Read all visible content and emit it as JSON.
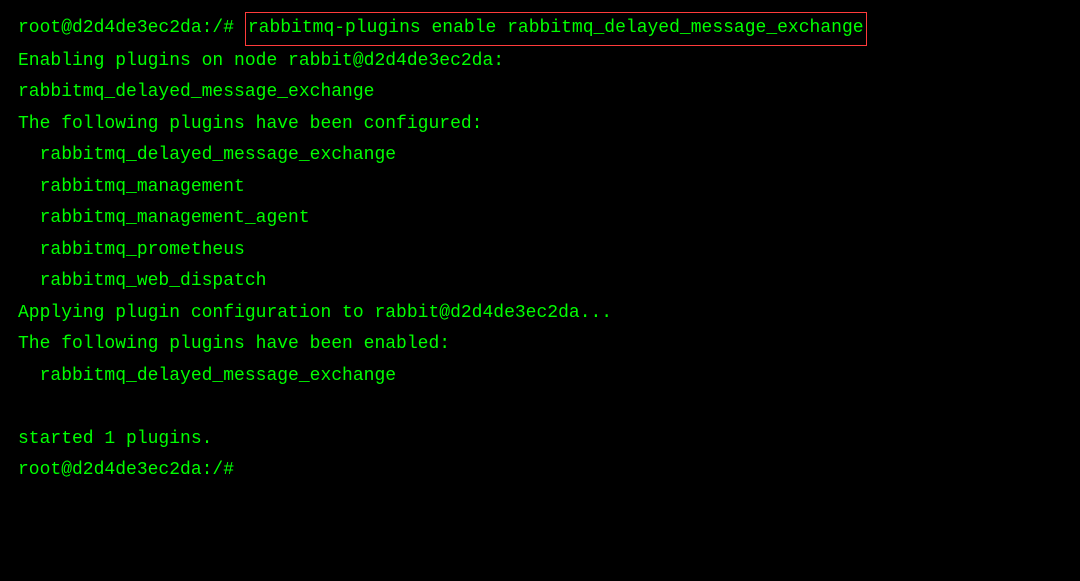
{
  "terminal": {
    "prompt1_prefix": "root@d2d4de3ec2da:/# ",
    "command": "rabbitmq-plugins enable rabbitmq_delayed_message_exchange",
    "line2": "Enabling plugins on node rabbit@d2d4de3ec2da:",
    "line3": "rabbitmq_delayed_message_exchange",
    "line4": "The following plugins have been configured:",
    "line5": "  rabbitmq_delayed_message_exchange",
    "line6": "  rabbitmq_management",
    "line7": "  rabbitmq_management_agent",
    "line8": "  rabbitmq_prometheus",
    "line9": "  rabbitmq_web_dispatch",
    "line10": "Applying plugin configuration to rabbit@d2d4de3ec2da...",
    "line11": "The following plugins have been enabled:",
    "line12": "  rabbitmq_delayed_message_exchange",
    "line13": " ",
    "line14": "started 1 plugins.",
    "prompt2": "root@d2d4de3ec2da:/# "
  }
}
